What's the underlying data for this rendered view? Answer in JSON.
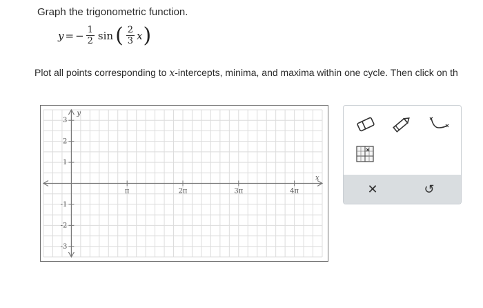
{
  "prompt": "Graph the trigonometric function.",
  "equation": {
    "lhs": "y",
    "equals": "=",
    "sign": "−",
    "coef_num": "1",
    "coef_den": "2",
    "func": "sin",
    "arg_num": "2",
    "arg_den": "3",
    "var": "x"
  },
  "instruction": {
    "part1": "Plot all points corresponding to ",
    "var": "x",
    "part2": "-intercepts, minima, and maxima within one cycle. Then click on th"
  },
  "graph": {
    "x_axis_label": "x",
    "y_axis_label": "y",
    "x_tick_labels": [
      "π",
      "2π",
      "3π",
      "4π"
    ],
    "y_tick_labels": [
      "3",
      "2",
      "1",
      "-1",
      "-2",
      "-3"
    ],
    "x_range": [
      -0.5,
      4.5
    ],
    "y_range": [
      -3.5,
      3.5
    ],
    "grid": true
  },
  "toolbar": {
    "tools": [
      {
        "name": "eraser-tool",
        "icon": "eraser-icon"
      },
      {
        "name": "pencil-tool",
        "icon": "pencil-icon"
      },
      {
        "name": "sine-curve-tool",
        "icon": "sine-curve-icon"
      },
      {
        "name": "grid-options-tool",
        "icon": "grid-icon"
      }
    ],
    "footer": {
      "clear": "✕",
      "undo": "↺"
    }
  }
}
